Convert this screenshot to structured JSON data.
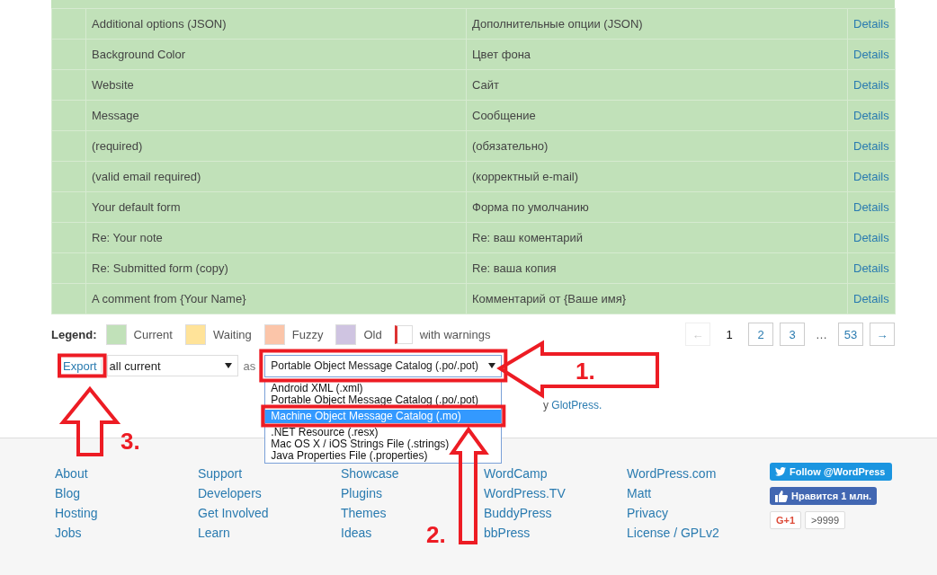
{
  "table": {
    "rows": [
      {
        "color": "#c1e1b9",
        "original": "Additional options (JSON)",
        "translation": "Дополнительные опции (JSON)",
        "action": "Details"
      },
      {
        "color": "#c1e1b9",
        "original": "Background Color",
        "translation": "Цвет фона",
        "action": "Details"
      },
      {
        "color": "#c1e1b9",
        "original": "Website",
        "translation": "Сайт",
        "action": "Details"
      },
      {
        "color": "#c1e1b9",
        "original": "Message",
        "translation": "Сообщение",
        "action": "Details"
      },
      {
        "color": "#c1e1b9",
        "original": "(required)",
        "translation": "(обязательно)",
        "action": "Details"
      },
      {
        "color": "#c1e1b9",
        "original": "(valid email required)",
        "translation": "(корректный e-mail)",
        "action": "Details"
      },
      {
        "color": "#c1e1b9",
        "original": "Your default form",
        "translation": "Форма по умолчанию",
        "action": "Details"
      },
      {
        "color": "#c1e1b9",
        "original": "Re: Your note",
        "translation": "Re: ваш коментарий",
        "action": "Details"
      },
      {
        "color": "#c1e1b9",
        "original": "Re: Submitted form (copy)",
        "translation": "Re: ваша копия",
        "action": "Details"
      },
      {
        "color": "#c1e1b9",
        "original": "A comment from {Your Name}",
        "translation": "Комментарий от {Ваше имя}",
        "action": "Details"
      }
    ]
  },
  "legend": {
    "title": "Legend:",
    "items": [
      {
        "kind": "swatch",
        "label": "Current",
        "color": "#c1e1b9"
      },
      {
        "kind": "swatch",
        "label": "Waiting",
        "color": "#ffe399"
      },
      {
        "kind": "swatch",
        "label": "Fuzzy",
        "color": "#fbc5a9"
      },
      {
        "kind": "swatch",
        "label": "Old",
        "color": "#cfc4e1"
      },
      {
        "kind": "warning",
        "label": "with warnings",
        "color": "#dd3333"
      }
    ]
  },
  "pagination": [
    {
      "label": "←",
      "kind": "arrow",
      "disabled": true,
      "selected": false
    },
    {
      "label": "1",
      "kind": "page",
      "disabled": false,
      "selected": true
    },
    {
      "label": "2",
      "kind": "page",
      "disabled": false,
      "selected": false
    },
    {
      "label": "3",
      "kind": "page",
      "disabled": false,
      "selected": false
    },
    {
      "label": "…",
      "kind": "gap",
      "disabled": false,
      "selected": false
    },
    {
      "label": "53",
      "kind": "page",
      "disabled": false,
      "selected": false
    },
    {
      "label": "→",
      "kind": "arrow",
      "disabled": false,
      "selected": false
    }
  ],
  "export": {
    "link": "Export",
    "filter": "all current",
    "as": "as",
    "format": "Portable Object Message Catalog (.po/.pot)",
    "options": [
      {
        "label": "Android XML (.xml)",
        "selected": false
      },
      {
        "label": "Portable Object Message Catalog (.po/.pot)",
        "selected": false
      },
      {
        "label": "Machine Object Message Catalog (.mo)",
        "selected": true
      },
      {
        "label": ".NET Resource (.resx)",
        "selected": false
      },
      {
        "label": "Mac OS X / iOS Strings File (.strings)",
        "selected": false
      },
      {
        "label": "Java Properties File (.properties)",
        "selected": false
      }
    ]
  },
  "credit": {
    "text": "y",
    "link": "GlotPress."
  },
  "footer": {
    "columns": [
      [
        "About",
        "Blog",
        "Hosting",
        "Jobs"
      ],
      [
        "Support",
        "Developers",
        "Get Involved",
        "Learn"
      ],
      [
        "Showcase",
        "Plugins",
        "Themes",
        "Ideas"
      ],
      [
        "WordCamp",
        "WordPress.TV",
        "BuddyPress",
        "bbPress"
      ],
      [
        "WordPress.com",
        "Matt",
        "Privacy",
        "License / GPLv2"
      ]
    ],
    "social": {
      "twitter": "Follow @WordPress",
      "facebook": "Нравится 1 млн.",
      "gplus": "G+1",
      "gplus_count": ">9999"
    }
  },
  "annotations": [
    {
      "label": "1."
    },
    {
      "label": "2."
    },
    {
      "label": "3."
    }
  ]
}
